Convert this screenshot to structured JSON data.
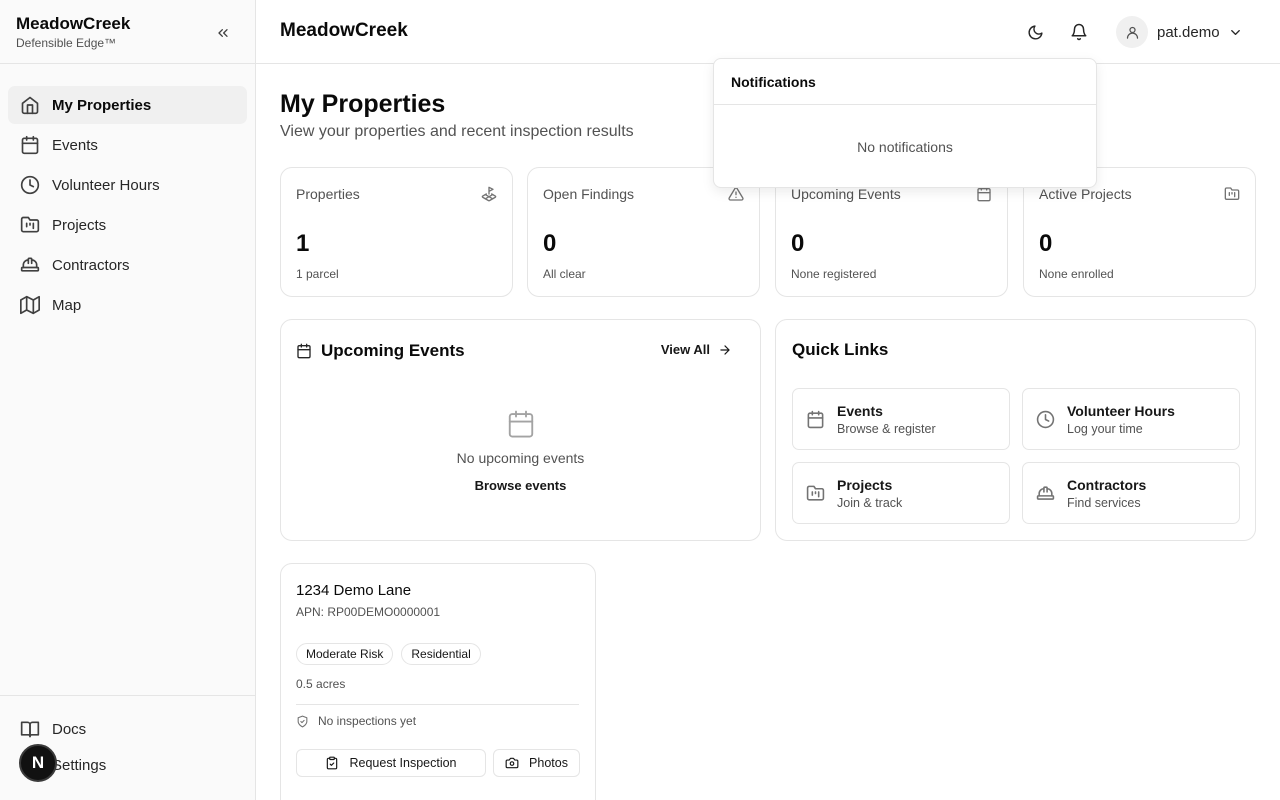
{
  "brand": {
    "name": "MeadowCreek",
    "tagline": "Defensible Edge™"
  },
  "sidebar": {
    "items": [
      {
        "label": "My Properties",
        "icon": "home-icon",
        "active": true
      },
      {
        "label": "Events",
        "icon": "calendar-icon"
      },
      {
        "label": "Volunteer Hours",
        "icon": "clock-icon"
      },
      {
        "label": "Projects",
        "icon": "folder-kanban-icon"
      },
      {
        "label": "Contractors",
        "icon": "hard-hat-icon"
      },
      {
        "label": "Map",
        "icon": "map-icon"
      }
    ],
    "bottom": [
      {
        "label": "Docs",
        "icon": "book-icon"
      },
      {
        "label": "Settings",
        "icon": "gear-icon"
      }
    ],
    "avatar_letter": "N"
  },
  "header": {
    "title": "MeadowCreek",
    "username": "pat.demo"
  },
  "page": {
    "title": "My Properties",
    "subtitle": "View your properties and recent inspection results"
  },
  "stats": [
    {
      "label": "Properties",
      "value": "1",
      "sub": "1 parcel",
      "icon": "land-plot-icon"
    },
    {
      "label": "Open Findings",
      "value": "0",
      "sub": "All clear",
      "icon": "alert-triangle-icon"
    },
    {
      "label": "Upcoming Events",
      "value": "0",
      "sub": "None registered",
      "icon": "calendar-icon"
    },
    {
      "label": "Active Projects",
      "value": "0",
      "sub": "None enrolled",
      "icon": "folder-kanban-icon"
    }
  ],
  "upcoming_events": {
    "title": "Upcoming Events",
    "view_all": "View All",
    "empty": "No upcoming events",
    "browse": "Browse events"
  },
  "quick_links": {
    "title": "Quick Links",
    "items": [
      {
        "name": "Events",
        "desc": "Browse & register",
        "icon": "calendar-icon"
      },
      {
        "name": "Volunteer Hours",
        "desc": "Log your time",
        "icon": "clock-icon"
      },
      {
        "name": "Projects",
        "desc": "Join & track",
        "icon": "folder-kanban-icon"
      },
      {
        "name": "Contractors",
        "desc": "Find services",
        "icon": "hard-hat-icon"
      }
    ]
  },
  "property": {
    "address": "1234 Demo Lane",
    "apn": "APN: RP00DEMO0000001",
    "badges": [
      "Moderate Risk",
      "Residential"
    ],
    "acres": "0.5 acres",
    "inspection_status": "No inspections yet",
    "request_button": "Request Inspection",
    "photos_button": "Photos"
  },
  "notifications": {
    "title": "Notifications",
    "empty": "No notifications"
  }
}
